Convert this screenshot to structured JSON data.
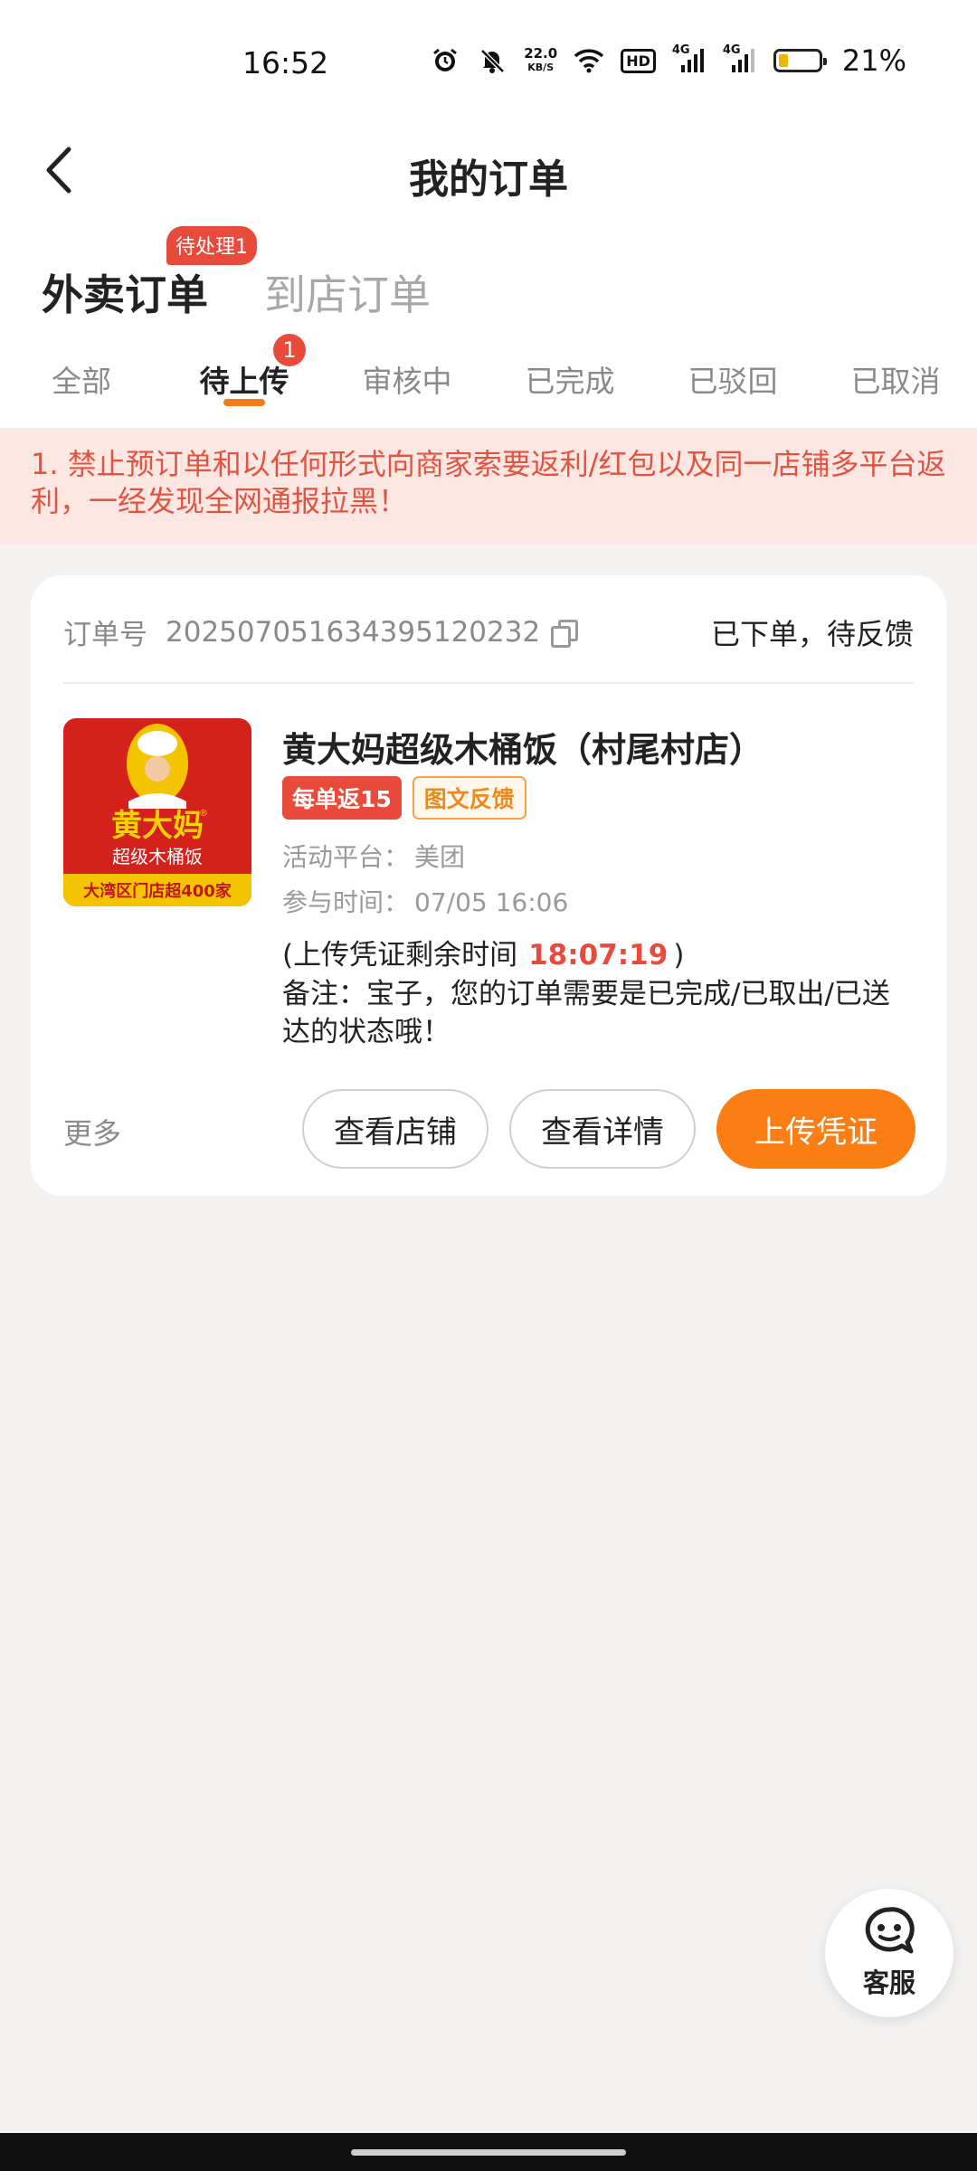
{
  "status_bar": {
    "time": "16:52",
    "net_speed_value": "22.0",
    "net_speed_unit": "KB/S",
    "hd_label": "HD",
    "signal_1": "4G",
    "signal_2": "4G",
    "battery_percent": "21%",
    "battery_level": 0.21
  },
  "nav": {
    "title": "我的订单",
    "back_icon": "chevron-left-icon"
  },
  "category_tabs": [
    {
      "label": "外卖订单",
      "badge": "待处理1",
      "active": true
    },
    {
      "label": "到店订单",
      "active": false
    }
  ],
  "status_tabs": [
    {
      "label": "全部"
    },
    {
      "label": "待上传",
      "badge": "1",
      "active": true
    },
    {
      "label": "审核中"
    },
    {
      "label": "已完成"
    },
    {
      "label": "已驳回"
    },
    {
      "label": "已取消"
    }
  ],
  "notice": "1. 禁止预订单和以任何形式向商家索要返利/红包以及同一店铺多平台返利，一经发现全网通报拉黑！",
  "order": {
    "order_no_label": "订单号",
    "order_no": "202507051634395120232",
    "status": "已下单，待反馈",
    "shop_name": "黄大妈超级木桶饭（村尾村店）",
    "logo": {
      "title": "黄大妈",
      "subtitle": "超级木桶饭",
      "footer": "大湾区门店超400家",
      "registered": "®"
    },
    "tags": [
      "每单返15",
      "图文反馈"
    ],
    "platform_label": "活动平台：",
    "platform": "美团",
    "join_time_label": "参与时间：",
    "join_time": "07/05 16:06",
    "deadline_prefix": "(上传凭证剩余时间",
    "deadline_time": "18:07:19",
    "deadline_suffix": ")",
    "remark": "备注：宝子，您的订单需要是已完成/已取出/已送达的状态哦！",
    "more_label": "更多",
    "buttons": {
      "view_shop": "查看店铺",
      "view_detail": "查看详情",
      "upload": "上传凭证"
    }
  },
  "service": {
    "label": "客服",
    "icon": "customer-service-icon"
  },
  "colors": {
    "accent_orange": "#fa7e14",
    "badge_red": "#e84b3c",
    "notice_bg": "#fde7e2",
    "notice_text": "#e15441",
    "page_bg": "#f3f2f1"
  }
}
